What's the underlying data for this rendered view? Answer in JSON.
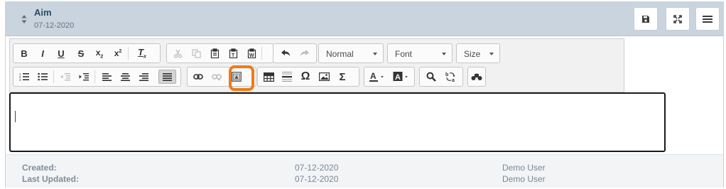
{
  "header": {
    "title": "Aim",
    "date": "07-12-2020",
    "buttons": [
      "save-icon",
      "expand-icon",
      "menu-icon"
    ]
  },
  "toolbar": {
    "format_select": "Normal",
    "font_select": "Font",
    "size_select": "Size",
    "omega": "Ω",
    "sigma": "Σ",
    "highlighted_button": "iframe-icon"
  },
  "footer": {
    "created_label": "Created:",
    "updated_label": "Last Updated:",
    "created_date": "07-12-2020",
    "updated_date": "07-12-2020",
    "created_by": "Demo User",
    "updated_by": "Demo User"
  },
  "colors": {
    "header_bg": "#c9d4de",
    "highlight": "#f07a1a",
    "title": "#2c4a66"
  }
}
